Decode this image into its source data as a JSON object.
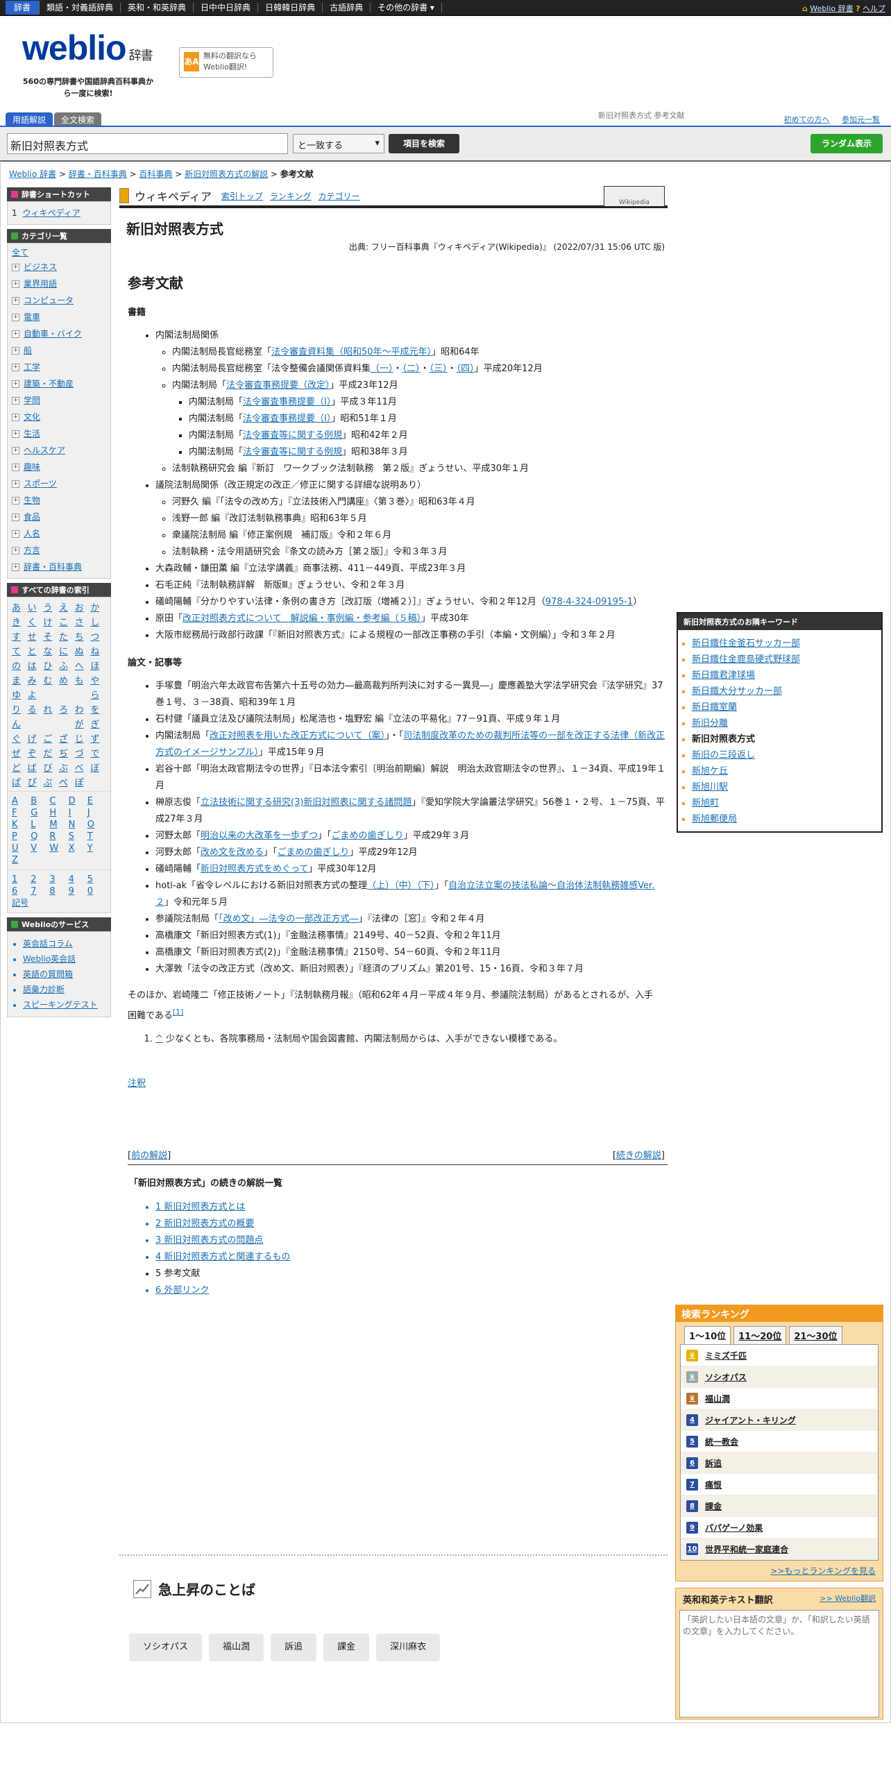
{
  "topnav": {
    "tabs": [
      "辞書",
      "類語・対義語辞典",
      "英和・和英辞典",
      "日中中日辞典",
      "日韓韓日辞典",
      "古語辞典",
      "その他の辞書 ▾"
    ],
    "weblio_dict": "Weblio 辞書",
    "help": "ヘルプ"
  },
  "logo": {
    "name": "weblio",
    "suffix": "辞書",
    "tagline": "560の専門辞書や国語辞典百科事典から一度に検索!"
  },
  "translate_banner": {
    "line1": "無料の翻訳なら",
    "line2": "Weblio翻訳!",
    "icon": "あA"
  },
  "search": {
    "tab_active": "用語解説",
    "tab_other": "全文検索",
    "query_hint": "新旧対照表方式 参考文献",
    "link_beginner": "初めての方へ",
    "link_join": "参加元一覧",
    "value": "新旧対照表方式",
    "match": "と一致する",
    "button": "項目を検索",
    "random": "ランダム表示"
  },
  "breadcrumb": [
    "Weblio 辞書",
    "辞書・百科事典",
    "百科事典",
    "新旧対照表方式の解説",
    "参考文献"
  ],
  "sidebar": {
    "shortcut_title": "辞書ショートカット",
    "shortcut_items": [
      {
        "num": "1",
        "label": "ウィキペディア"
      }
    ],
    "category_title": "カテゴリ一覧",
    "category_all": "全て",
    "categories": [
      "ビジネス",
      "業界用語",
      "コンピュータ",
      "電車",
      "自動車・バイク",
      "船",
      "工学",
      "建築・不動産",
      "学問",
      "文化",
      "生活",
      "ヘルスケア",
      "趣味",
      "スポーツ",
      "生物",
      "食品",
      "人名",
      "方言",
      "辞書・百科事典"
    ],
    "index_title": "すべての辞書の索引",
    "kana": [
      "あ",
      "い",
      "う",
      "え",
      "お",
      "か",
      "き",
      "く",
      "け",
      "こ",
      "さ",
      "し",
      "す",
      "せ",
      "そ",
      "た",
      "ち",
      "つ",
      "て",
      "と",
      "な",
      "に",
      "ぬ",
      "ね",
      "の",
      "は",
      "ひ",
      "ふ",
      "へ",
      "ほ",
      "ま",
      "み",
      "む",
      "め",
      "も",
      "や",
      "ゆ",
      "よ",
      "",
      "",
      "",
      "ら",
      "り",
      "る",
      "れ",
      "ろ",
      "わ",
      "を",
      "ん",
      "",
      "",
      "",
      "が",
      "ぎ",
      "ぐ",
      "げ",
      "ご",
      "ざ",
      "じ",
      "ず",
      "ぜ",
      "ぞ",
      "だ",
      "ぢ",
      "づ",
      "で",
      "ど",
      "ば",
      "び",
      "ぶ",
      "べ",
      "ぼ",
      "ぱ",
      "ぴ",
      "ぷ",
      "ぺ",
      "ぽ"
    ],
    "alpha": [
      "A",
      "B",
      "C",
      "D",
      "E",
      "F",
      "G",
      "H",
      "I",
      "J",
      "K",
      "L",
      "M",
      "N",
      "O",
      "P",
      "Q",
      "R",
      "S",
      "T",
      "U",
      "V",
      "W",
      "X",
      "Y",
      "Z"
    ],
    "digits": [
      "1",
      "2",
      "3",
      "4",
      "5",
      "6",
      "7",
      "8",
      "9",
      "0"
    ],
    "symbol": "記号",
    "services_title": "Weblioのサービス",
    "services": [
      "英会話コラム",
      "Weblio英会話",
      "英語の質問箱",
      "語彙力診断",
      "スピーキングテスト"
    ]
  },
  "wiki_header": {
    "name": "ウィキペディア",
    "links": [
      "索引トップ",
      "ランキング",
      "カテゴリー"
    ],
    "logo_text": "Wikipedia"
  },
  "article": {
    "title": "新旧対照表方式",
    "source": "出典: フリー百科事典『ウィキペディア(Wikipedia)』 (2022/07/31 15:06 UTC 版)",
    "section": "参考文献",
    "books_title": "書籍",
    "papers_title": "論文・記事等",
    "note": "そのほか、岩崎隆二「修正技術ノート」『法制執務月報』（昭和62年４月－平成４年９月、参議院法制局）があるとされるが、入手困難である",
    "note_ref": "[1]",
    "footnote_caret": "^",
    "footnote": "少なくとも、各院事務局・法制局や国会図書館、内閣法制局からは、入手ができない模様である。",
    "chunk_link": "注釈",
    "prev": "前の解説",
    "next": "続きの解説",
    "cont_title": "「新旧対照表方式」の続きの解説一覧",
    "cont_items": [
      "1 新旧対照表方式とは",
      "2 新旧対照表方式の概要",
      "3 新旧対照表方式の問題点",
      "4 新旧対照表方式と関連するもの",
      "5 参考文献",
      "6 外部リンク"
    ],
    "rise_title": "急上昇のことば",
    "rise_words": [
      "ソシオパス",
      "福山潤",
      "訴追",
      "課金",
      "深川麻衣"
    ]
  },
  "books": {
    "b1": "内閣法制局関係",
    "b1_1a": "内閣法制局長官総務室「",
    "b1_1l": "法令審査資料集（昭和50年～平成元年）",
    "b1_1b": "」昭和64年",
    "b1_2a": "内閣法制局長官総務室「法令整備会議関係資料集",
    "b1_2l1": "（一）",
    "b1_2l2": "（二）",
    "b1_2l3": "（三）",
    "b1_2l4": "（四）",
    "b1_2b": "」平成20年12月",
    "b1_3a": "内閣法制局「",
    "b1_3l": "法令審査事務提要（改定）",
    "b1_3b": "」平成23年12月",
    "b1_3_1a": "内閣法制局「",
    "b1_3_1l": "法令審査事務提要（Ⅰ）",
    "b1_3_1b": "」平成３年11月",
    "b1_3_2a": "内閣法制局「",
    "b1_3_2l": "法令審査事務提要（Ⅰ）",
    "b1_3_2b": "」昭和51年１月",
    "b1_3_3a": "内閣法制局「",
    "b1_3_3l": "法令審査等に関する例規",
    "b1_3_3b": "」昭和42年２月",
    "b1_3_4a": "内閣法制局「",
    "b1_3_4l": "法令審査等に関する例規",
    "b1_3_4b": "」昭和38年３月",
    "b1_4": "法制執務研究会 編『新訂　ワークブック法制執務　第２版』ぎょうせい、平成30年１月",
    "b2": "議院法制局関係（改正規定の改正／修正に関する詳細な説明あり）",
    "b2_1": "河野久 編『「法令の改め方」『立法技術入門講座』〈第３巻〉』昭和63年４月",
    "b2_2": "浅野一郎 編『改訂法制執務事典』昭和63年５月",
    "b2_3": "衆議院法制局 編『修正案例規　補訂版』令和２年６月",
    "b2_4": "法制執務・法令用語研究会『条文の読み方［第２版］』令和３年３月",
    "b3": "大森政輔・鎌田薫 編『立法学講義』商事法務、411－449頁、平成23年３月",
    "b4": "石毛正純『法制執務詳解　新版Ⅲ』ぎょうせい、令和２年３月",
    "b5a": "礒崎陽輔『分かりやすい法律・条例の書き方［改訂版（増補２）］』ぎょうせい、令和２年12月（",
    "b5l": "978-4-324-09195-1",
    "b5b": "）",
    "b6a": "原田「",
    "b6l": "改正対照表方式について　解説編・事例編・参考編（５稿）",
    "b6b": "」平成30年",
    "b7": "大阪市総務局行政部行政課「『新旧対照表方式』による規程の一部改正事務の手引（本編・文例編）」令和３年２月"
  },
  "papers": {
    "p1": "手塚豊「明治六年太政官布告第六十五号の効力―最高裁判所判決に対する一異見―」慶應義塾大学法学研究会『法学研究』37巻１号、３－38頁、昭和39年１月",
    "p2": "石村健「議員立法及び議院法制局」松尾浩也・塩野宏 編『立法の平易化』77－91頁、平成９年１月",
    "p3a": "内閣法制局「",
    "p3l1": "改正対照表を用いた改正方式について（案）",
    "p3m": "」・「",
    "p3l2": "司法制度改革のための裁判所法等の一部を改正する法律（新改正方式のイメージサンプル）",
    "p3b": "」平成15年９月",
    "p4": "岩谷十郎「明治太政官期法令の世界」『日本法令索引〔明治前期編〕解説　明治太政官期法令の世界』、１－34頁、平成19年１月",
    "p5a": "榊原志俊「",
    "p5l": "立法技術に関する研究(3)新旧対照表に関する諸問題",
    "p5b": "」『愛知学院大学論叢法学研究』56巻１・２号、１－75頁、平成27年３月",
    "p6a": "河野太郎「",
    "p6l1": "明治以来の大改革を一歩ずつ",
    "p6m": "」「",
    "p6l2": "ごまめの歯ぎしり",
    "p6b": "」平成29年３月",
    "p7a": "河野太郎「",
    "p7l1": "改め文を改める",
    "p7m": "」「",
    "p7l2": "ごまめの歯ぎしり",
    "p7b": "」平成29年12月",
    "p8a": "礒崎陽輔「",
    "p8l": "新旧対照表方式をめぐって",
    "p8b": "」平成30年12月",
    "p9a": "hoti-ak「省令レベルにおける新旧対照表方式の整理",
    "p9l1": "（上）",
    "p9l2": "（中）",
    "p9l3": "（下）",
    "p9m": "」「",
    "p9l4": "自治立法立案の技法私論～自治体法制執務雑感Ver.２",
    "p9b": "」令和元年５月",
    "p10a": "参議院法制局「",
    "p10l": "「改め文」―法令の一部改正方式―",
    "p10b": "」『法律の［窓］』令和２年４月",
    "p11": "高橋康文「新旧対照表方式(1)」『金融法務事情』2149号、40－52頁、令和２年11月",
    "p12": "高橋康文「新旧対照表方式(2)」『金融法務事情』2150号、54－60頁、令和２年11月",
    "p13": "大澤敦「法令の改正方式（改め文、新旧対照表）」『経済のプリズム』第201号、15・16頁、令和３年７月"
  },
  "keywords": {
    "title": "新旧対照表方式のお隣キーワード",
    "items": [
      "新日鐵住金釜石サッカー部",
      "新日鐵住金鹿島硬式野球部",
      "新日鐵君津球場",
      "新日鐵大分サッカー部",
      "新日鐵室蘭",
      "新旧分離",
      "新旧対照表方式",
      "新旧の三段返し",
      "新旭ケ丘",
      "新旭川駅",
      "新旭町",
      "新旭郵便局"
    ],
    "current_index": 6
  },
  "ranking": {
    "title": "検索ランキング",
    "tabs": [
      "1～10位",
      "11～20位",
      "21～30位"
    ],
    "items": [
      "ミミズ千匹",
      "ソシオパス",
      "福山潤",
      "ジャイアント・キリング",
      "統一教会",
      "訴追",
      "痛恨",
      "課金",
      "パパゲーノ効果",
      "世界平和統一家庭連合"
    ],
    "more": ">>もっとランキングを見る"
  },
  "ej": {
    "title": "英和和英テキスト翻訳",
    "link": ">> Weblio翻訳",
    "placeholder": "「英訳したい日本語の文章」か、「和訳したい英語の文章」を入力してください。"
  },
  "colors": {
    "accent_blue": "#2b63c9",
    "link": "#1a6fb5",
    "orange": "#f29a1e",
    "green": "#2da52d"
  }
}
